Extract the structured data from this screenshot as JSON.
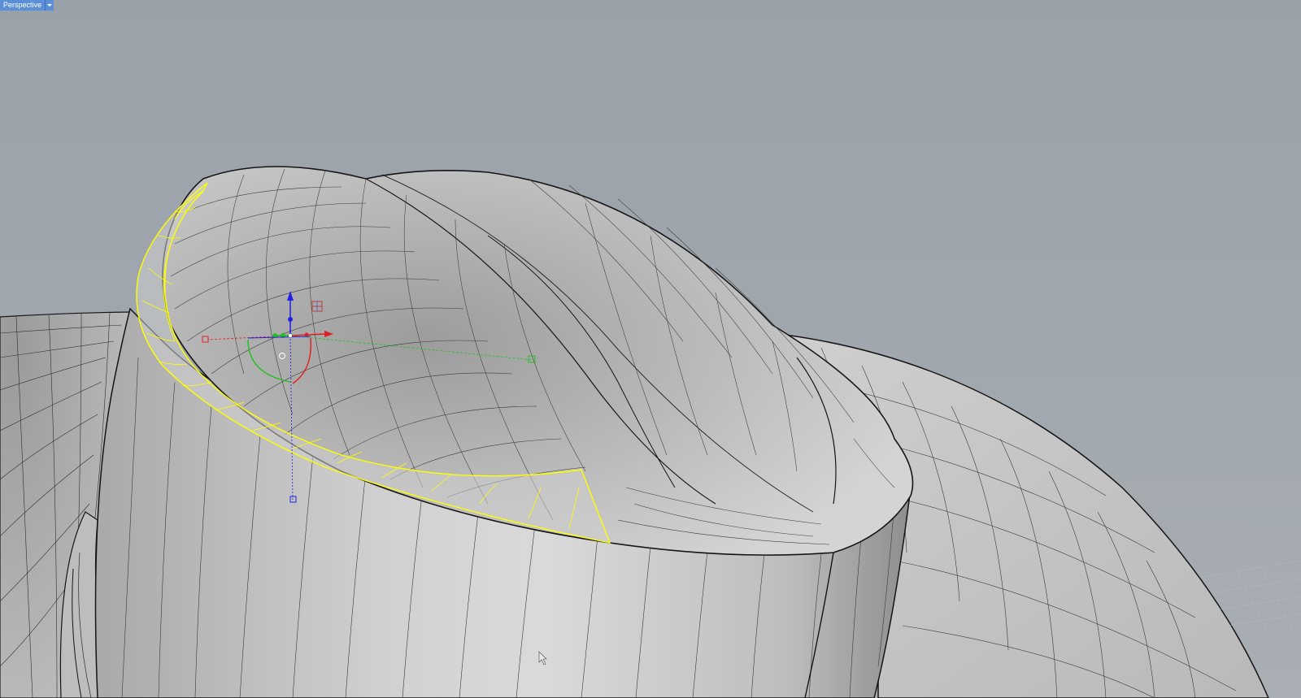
{
  "viewport": {
    "title": "Perspective",
    "menu_icon": "chevron-down-icon"
  },
  "scene": {
    "selection_color": "#ffff00",
    "wire_color": "#1a1a1a",
    "surface_color": "#c9c9c9",
    "background_color": "#9ea4ab"
  },
  "gumball": {
    "x_axis_color": "#e02020",
    "y_axis_color": "#20c020",
    "z_axis_color": "#2020e0"
  }
}
